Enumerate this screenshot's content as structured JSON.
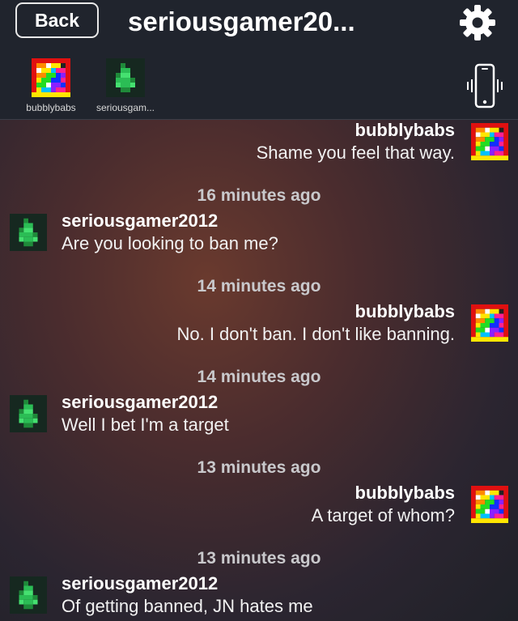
{
  "nav": {
    "back_label": "Back",
    "title": "seriousgamer20...",
    "settings_icon": "gear-icon"
  },
  "participants": [
    {
      "label": "bubblybabs",
      "avatar": "rainbow-pixel-avatar"
    },
    {
      "label": "seriousgam...",
      "avatar": "green-pixel-avatar"
    }
  ],
  "phone_icon": "phone-vibrate-icon",
  "messages": [
    {
      "side": "right",
      "name": "bubblybabs",
      "text": "Shame you feel that way."
    },
    {
      "timestamp": "16 minutes ago"
    },
    {
      "side": "left",
      "name": "seriousgamer2012",
      "text": "Are you looking to ban me?"
    },
    {
      "timestamp": "14 minutes ago"
    },
    {
      "side": "right",
      "name": "bubblybabs",
      "text": "No.  I don't ban.  I don't like banning."
    },
    {
      "timestamp": "14 minutes ago"
    },
    {
      "side": "left",
      "name": "seriousgamer2012",
      "text": "Well I bet I'm a target"
    },
    {
      "timestamp": "13 minutes ago"
    },
    {
      "side": "right",
      "name": "bubblybabs",
      "text": "A target of whom?"
    },
    {
      "timestamp": "13 minutes ago"
    },
    {
      "side": "left",
      "name": "seriousgamer2012",
      "text": "Of getting banned, JN hates me"
    }
  ]
}
